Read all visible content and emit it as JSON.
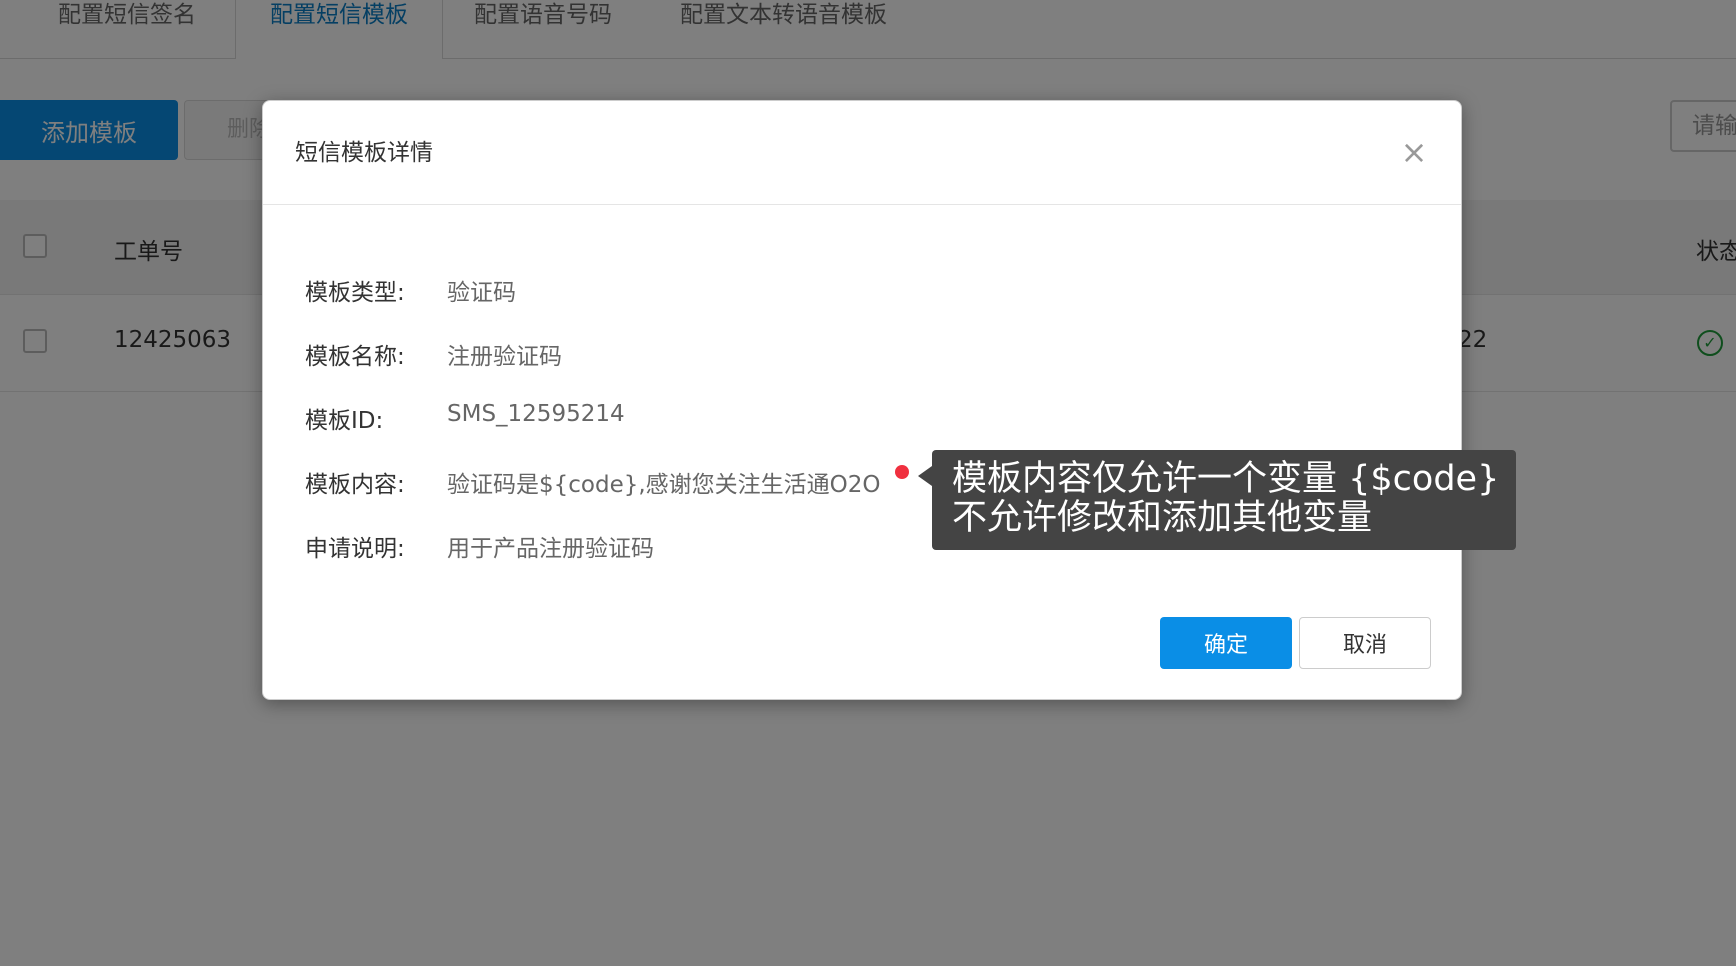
{
  "tabs": [
    {
      "label": "配置短信签名"
    },
    {
      "label": "配置短信模板",
      "active": true
    },
    {
      "label": "配置语音号码"
    },
    {
      "label": "配置文本转语音模板"
    }
  ],
  "toolbar": {
    "add_label": "添加模板",
    "delete_label": "删除",
    "search_placeholder": "请输"
  },
  "table": {
    "headers": {
      "ticket_no": "工单号",
      "status": "状态"
    },
    "rows": [
      {
        "ticket_no": "12425063",
        "partial_cell": "22",
        "status_icon": "check-circle-icon"
      }
    ]
  },
  "modal": {
    "title": "短信模板详情",
    "close_icon": "close-icon",
    "fields": [
      {
        "label": "模板类型:",
        "value": "验证码"
      },
      {
        "label": "模板名称:",
        "value": "注册验证码"
      },
      {
        "label": "模板ID:",
        "value": "SMS_12595214"
      },
      {
        "label": "模板内容:",
        "value": "验证码是${code},感谢您关注生活通O2O"
      },
      {
        "label": "申请说明:",
        "value": "用于产品注册验证码"
      }
    ],
    "ok_label": "确定",
    "cancel_label": "取消"
  },
  "tooltip": {
    "lines": [
      "模板内容仅允许一个变量 {$code}",
      "不允许修改和添加其他变量"
    ]
  },
  "colors": {
    "primary": "#0a8ee6",
    "active_tab": "#0a7fc6",
    "success": "#1e9c3a",
    "alert_dot": "#f0303f",
    "tooltip_bg": "#444444"
  }
}
